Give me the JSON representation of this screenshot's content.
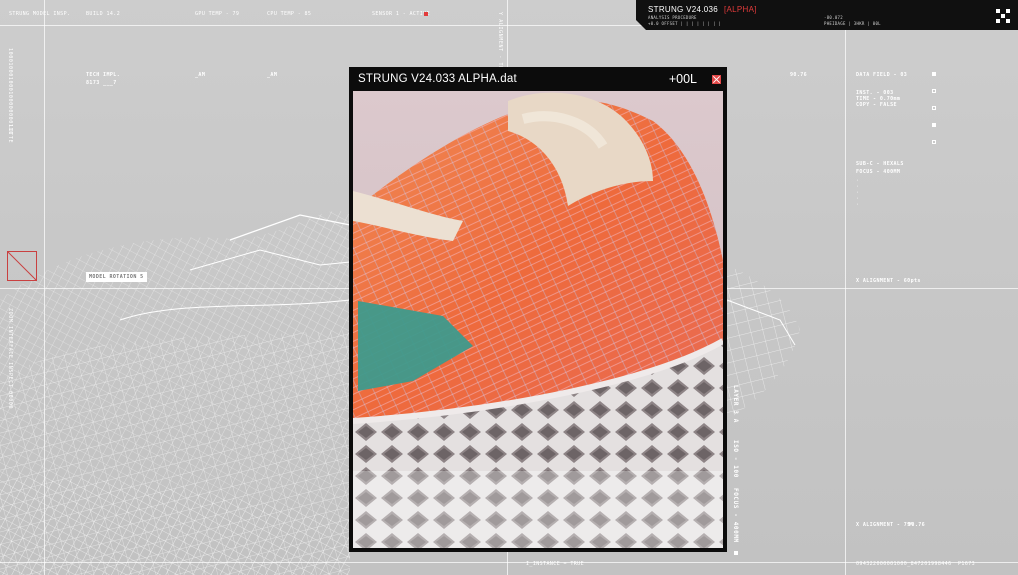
{
  "hud": {
    "top_labels": [
      "STRUNG MODEL INSP.",
      "BUILD 14.2",
      "GPU TEMP - 79",
      "CPU TEMP - 85",
      "SENSOR 1 - ACTIVE"
    ],
    "sensor_color": "#e23b3b",
    "tech_label": "TECH IMPL.",
    "tech_sub": "8173 ___7",
    "col_a": "_AM",
    "col_b": "_AM",
    "model_rotation": "MODEL ROTATION  5",
    "left_vertical_top": "100010001000100000000111",
    "left_vertical_mid": "LOTTE",
    "left_vertical_bottom": "ZOOM INTERFACE INSPECT_00000",
    "center_vertical": "Y ALIGNMENT - TRUE",
    "right_value": "90.76",
    "data_field": "DATA FIELD - 03",
    "info_lines": [
      "INST. - 003",
      "TIME - 0.70mm",
      "COPY - FALSE"
    ],
    "sub_lines": [
      "SUB-C - HEXALS",
      "FOCUS - 400MM"
    ],
    "x_alignment_top": "X ALIGNMENT - 60pts",
    "x_alignment_bottom": "X ALIGNMENT - 79%",
    "x_alignment_value": "90.76",
    "iso_label": "ISO - 100",
    "focus_label": "FOCUS - 400MM",
    "layer_label": "LAYER 3 A",
    "instance_label": "I_INSTANCE = TRUE",
    "bottom_code": "094322000001000_847201998446",
    "bottom_small": "P1673"
  },
  "top_right_panel": {
    "title": "STRUNG V24.036",
    "badge": "[ALPHA]",
    "line1": "ANALYSIS PROCEDURE",
    "line2": "+0.0 OFFSET | | | | | | | |",
    "right1": "-80.072",
    "right2": "PHEIDAGE | 3HKR | 00L"
  },
  "window": {
    "title": "STRUNG V24.033 ALPHA.dat",
    "code": "+00L",
    "close_color": "#e24848"
  },
  "icons": {
    "close": "close-icon",
    "qr": "qr-icon"
  }
}
